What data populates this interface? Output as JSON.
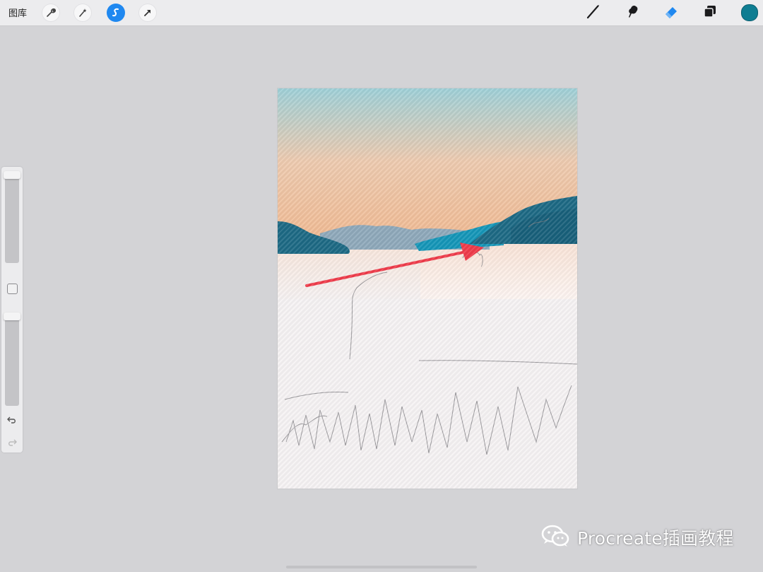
{
  "toolbar": {
    "gallery_label": "图库",
    "left_tools": [
      {
        "name": "wrench-icon"
      },
      {
        "name": "magic-wand-icon"
      },
      {
        "name": "selection-icon",
        "active": true
      },
      {
        "name": "transform-arrow-icon"
      }
    ],
    "right_tools": [
      {
        "name": "brush-icon"
      },
      {
        "name": "smudge-icon"
      },
      {
        "name": "eraser-icon",
        "active": true
      },
      {
        "name": "layers-icon"
      }
    ],
    "current_color": "#0e7d92"
  },
  "sidebar": {
    "brush_size_label": "",
    "opacity_label": ""
  },
  "canvas": {
    "sky_top_color": "#9fd0d8",
    "sky_bottom_color": "#f1b990",
    "mountain_color": "#1d6a85",
    "accent_mountain_color": "#1596b8",
    "annotation_arrow_color": "#ef3b4a"
  },
  "watermark": {
    "text": "Procreate插画教程",
    "icon": "wechat-icon"
  }
}
